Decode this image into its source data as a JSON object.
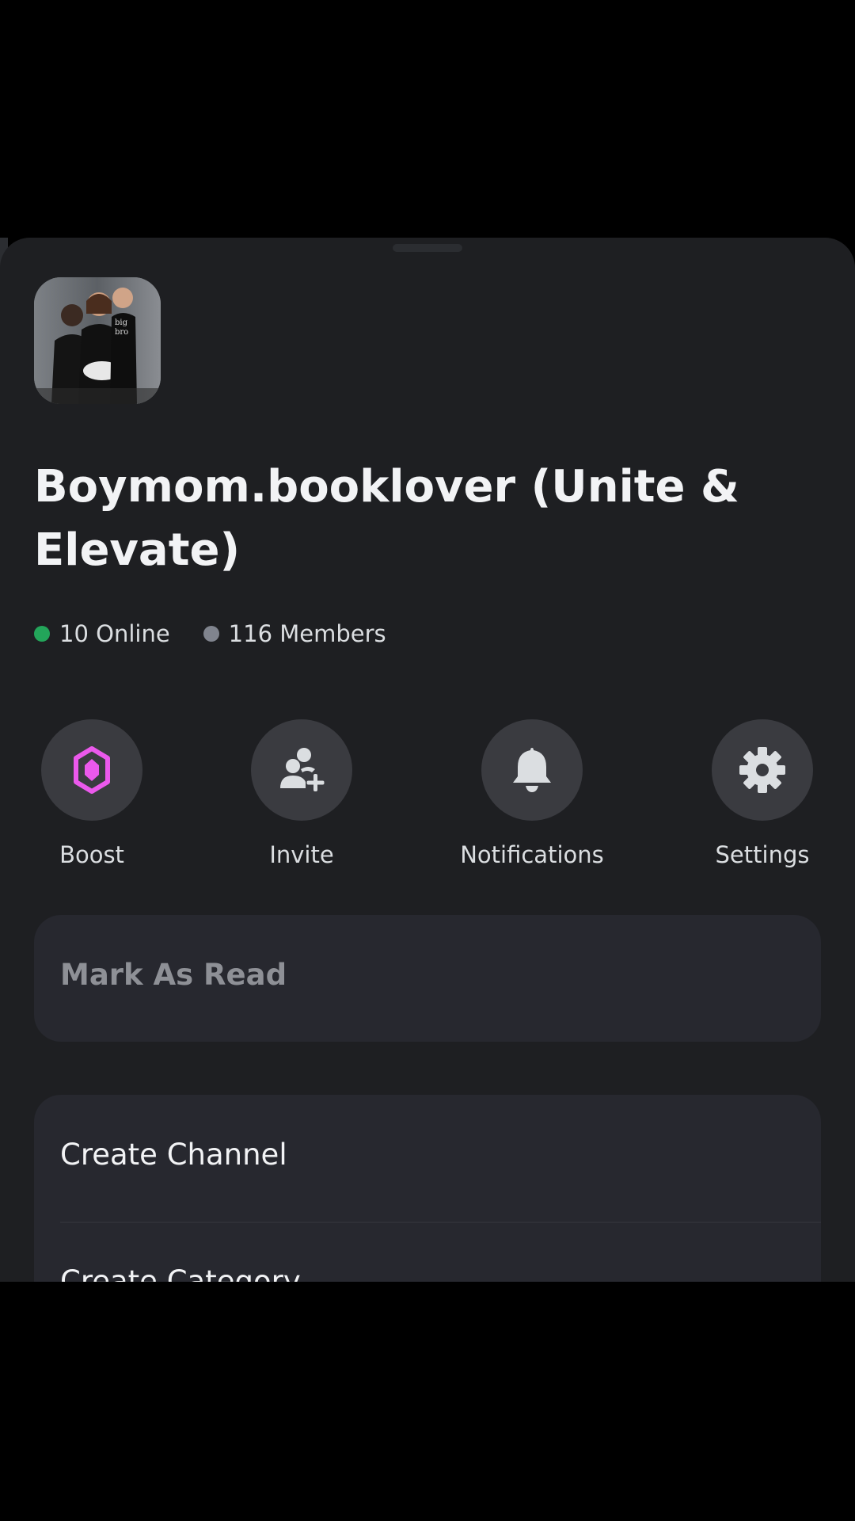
{
  "server": {
    "name": "Boymom.booklover (Unite & Elevate)",
    "icon": "server-photo-avatar"
  },
  "stats": {
    "online": "10 Online",
    "members": "116 Members",
    "online_color": "#23a55a",
    "members_color": "#80848e"
  },
  "actions": [
    {
      "label": "Boost",
      "icon": "nitro-boost-gem-icon",
      "color": "#eb59ec"
    },
    {
      "label": "Invite",
      "icon": "add-user-icon",
      "color": "#dbdee1"
    },
    {
      "label": "Notifications",
      "icon": "bell-icon",
      "color": "#dbdee1"
    },
    {
      "label": "Settings",
      "icon": "gear-icon",
      "color": "#dbdee1"
    }
  ],
  "mark_as_read": "Mark As Read",
  "menu": {
    "items": [
      {
        "label": "Create Channel"
      },
      {
        "label": "Create Category"
      }
    ]
  }
}
